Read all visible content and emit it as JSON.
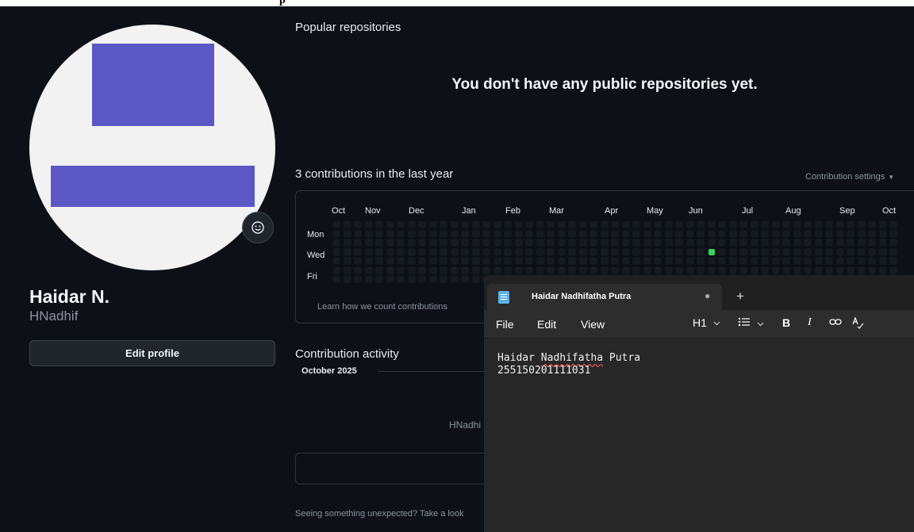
{
  "profile": {
    "name": "Haidar N.",
    "login": "HNadhif",
    "edit_label": "Edit profile"
  },
  "popular": {
    "title": "Popular repositories",
    "empty_message": "You don't have any public repositories yet."
  },
  "contributions": {
    "title": "3 contributions in the last year",
    "settings_label": "Contribution settings",
    "months": [
      "Oct",
      "Nov",
      "Dec",
      "Jan",
      "Feb",
      "Mar",
      "Apr",
      "May",
      "Jun",
      "Jul",
      "Aug",
      "Sep",
      "Oct"
    ],
    "days": [
      "Mon",
      "Wed",
      "Fri"
    ],
    "learn_link": "Learn how we count contributions",
    "colors": {
      "empty": "#161b22",
      "level1": "#39d353"
    }
  },
  "activity": {
    "title": "Contribution activity",
    "month": "October 2025",
    "user_partial": "HNadhi",
    "footer_partial": "Seeing something unexpected? Take a look"
  },
  "notepad": {
    "tab_title": "Haidar Nadhifatha Putra",
    "menu": {
      "file": "File",
      "edit": "Edit",
      "view": "View"
    },
    "toolbar": {
      "heading": "H1",
      "bold": "B",
      "italic": "I"
    },
    "content": {
      "line1_a": "Haidar ",
      "line1_err": "Nadhifatha",
      "line1_b": " Putra",
      "line2": "255150201111031"
    }
  }
}
